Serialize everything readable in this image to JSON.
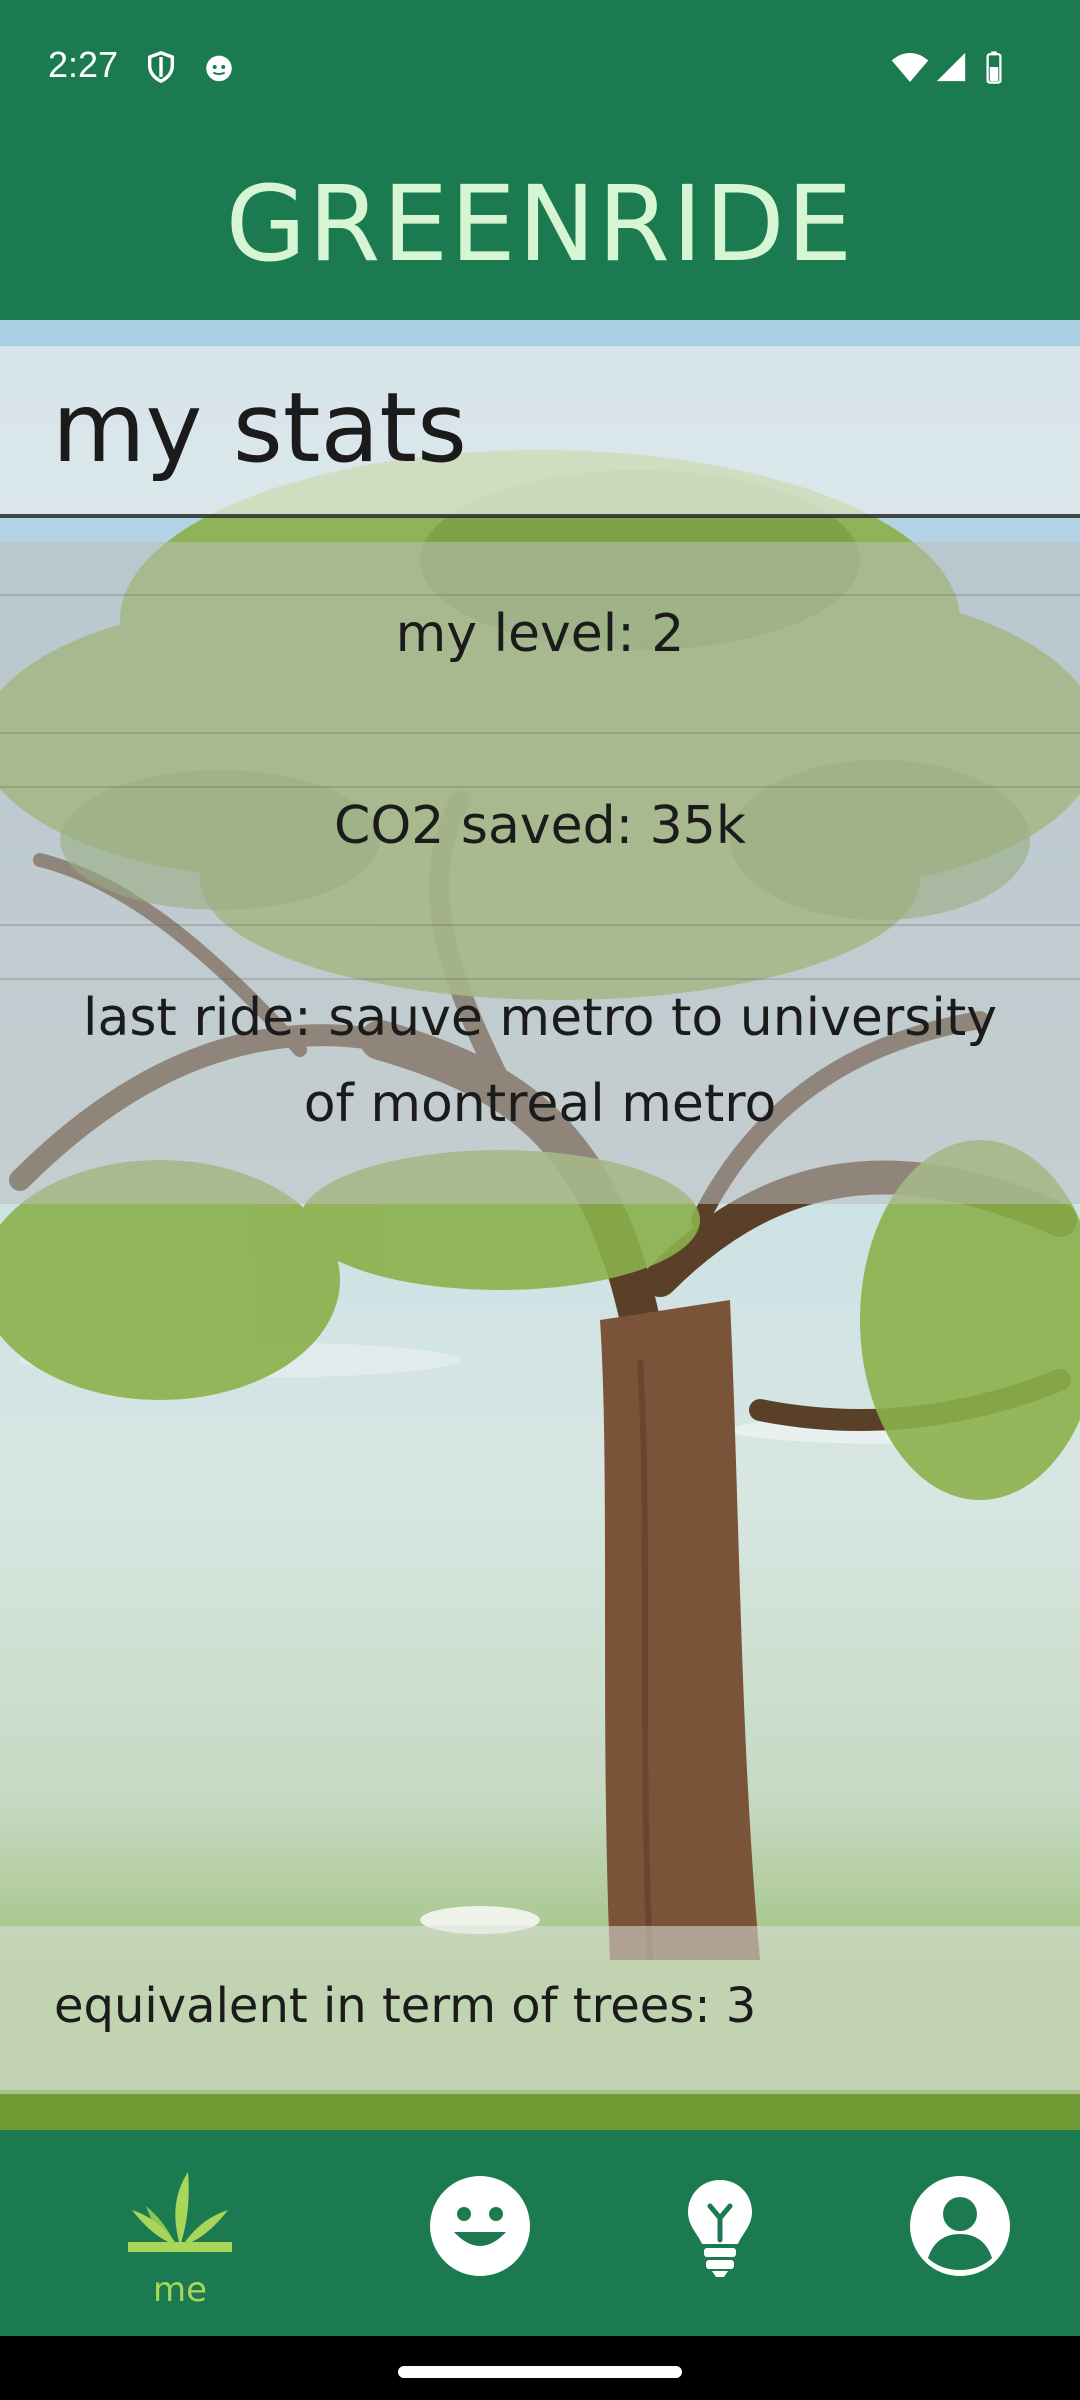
{
  "status_bar": {
    "time": "2:27",
    "icons": [
      "shield-icon",
      "cat-face-icon",
      "wifi-icon",
      "signal-icon",
      "battery-icon"
    ]
  },
  "app_bar": {
    "title": "GREENRIDE"
  },
  "stats": {
    "title": "my stats",
    "level": "my level: 2",
    "co2": "CO2 saved: 35k",
    "last_ride_line1": "last ride: sauve metro to university",
    "last_ride_line2": "of montreal metro",
    "trees": "equivalent in term of trees: 3"
  },
  "bottom_nav": {
    "items": [
      {
        "icon": "sprout-icon",
        "label": "me"
      },
      {
        "icon": "smiley-icon",
        "label": ""
      },
      {
        "icon": "lightbulb-icon",
        "label": ""
      },
      {
        "icon": "account-icon",
        "label": ""
      }
    ]
  },
  "colors": {
    "primary": "#1c7a50",
    "title_text": "#d6f5d2",
    "active_nav": "#a8d65a"
  }
}
